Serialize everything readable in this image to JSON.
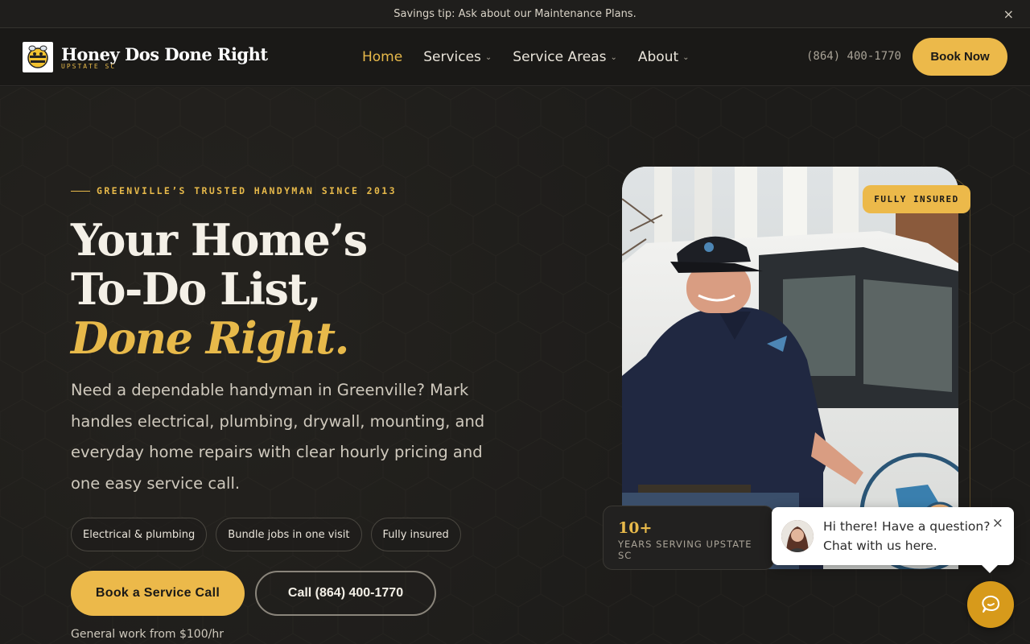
{
  "topbar": {
    "message": "Savings tip: Ask about our Maintenance Plans.",
    "close_label": "×"
  },
  "header": {
    "brand_name": "Honey Dos Done Right",
    "brand_sub": "UPSTATE SC",
    "nav": [
      {
        "label": "Home",
        "active": true,
        "has_menu": false
      },
      {
        "label": "Services",
        "active": false,
        "has_menu": true
      },
      {
        "label": "Service Areas",
        "active": false,
        "has_menu": true
      },
      {
        "label": "About",
        "active": false,
        "has_menu": true
      }
    ],
    "phone": "(864) 400-1770",
    "book_label": "Book Now"
  },
  "hero": {
    "eyebrow": "GREENVILLE’S TRUSTED HANDYMAN SINCE 2013",
    "headline_line1": "Your Home’s",
    "headline_line2": "To-Do List,",
    "headline_accent": "Done Right.",
    "lede": "Need a dependable handyman in Greenville? Mark handles electrical, plumbing, drywall, mounting, and everyday home repairs with clear hourly pricing and one easy service call.",
    "chips": [
      "Electrical & plumbing",
      "Bundle jobs in one visit",
      "Fully insured"
    ],
    "cta_primary": "Book a Service Call",
    "cta_secondary": "Call (864) 400-1770",
    "price_note": "General work from $100/hr",
    "badge": "FULLY INSURED",
    "stat_number": "10+",
    "stat_label": "YEARS SERVING UPSTATE SC"
  },
  "chat": {
    "line1": "Hi there! Have a question?",
    "line2": "Chat with us here.",
    "close_label": "×"
  },
  "colors": {
    "accent": "#ecb94a",
    "background": "#1c1b19",
    "text": "#f4f0e7"
  },
  "icons": [
    "close-icon",
    "chevron-down-icon",
    "bee-logo-icon",
    "chat-icon"
  ]
}
